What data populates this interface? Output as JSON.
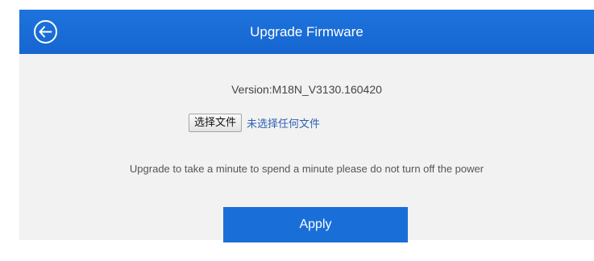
{
  "header": {
    "title": "Upgrade Firmware",
    "back_icon": "back-arrow-circle-icon",
    "color": "#1a6ed8"
  },
  "firmware": {
    "version": "Version:M18N_V3130.160420"
  },
  "file_picker": {
    "button_label": "选择文件",
    "status_text": "未选择任何文件"
  },
  "notice": {
    "text": "Upgrade to take a minute to spend a minute please do not turn off the power"
  },
  "actions": {
    "apply_label": "Apply"
  }
}
